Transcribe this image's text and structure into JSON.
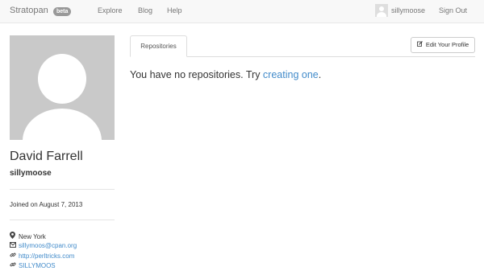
{
  "navbar": {
    "brand": "Stratopan",
    "badge": "beta",
    "links": [
      "Explore",
      "Blog",
      "Help"
    ],
    "user": "sillymoose",
    "sign_out": "Sign Out"
  },
  "profile": {
    "full_name": "David Farrell",
    "username": "sillymoose",
    "joined": "Joined on August 7, 2013",
    "location": "New York",
    "email": "sillymoos@cpan.org",
    "website": "http://perltricks.com",
    "cpan": "SILLYMOOS"
  },
  "main": {
    "tab": "Repositories",
    "edit_button": "Edit Your Profile",
    "empty_text": "You have no repositories. Try ",
    "empty_link": "creating one",
    "empty_suffix": "."
  },
  "colors": {
    "link": "#428bca",
    "navbar_bg": "#f8f8f8",
    "badge": "#999999"
  }
}
